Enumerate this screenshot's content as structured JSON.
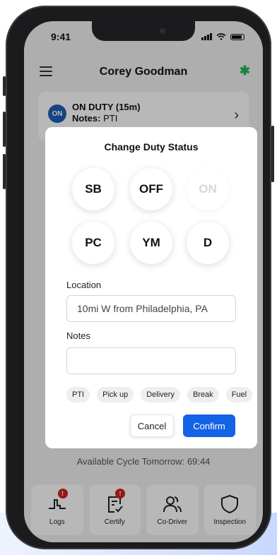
{
  "status_bar": {
    "time": "9:41"
  },
  "header": {
    "title": "Corey Goodman",
    "bluetooth_icon": "bluetooth-icon"
  },
  "duty_card": {
    "badge": "ON",
    "status": "ON DUTY (15m)",
    "notes_label": "Notes:",
    "notes_value": "PTI"
  },
  "modal": {
    "title": "Change Duty Status",
    "statuses": [
      {
        "label": "SB",
        "enabled": true
      },
      {
        "label": "OFF",
        "enabled": true
      },
      {
        "label": "ON",
        "enabled": false
      },
      {
        "label": "PC",
        "enabled": true
      },
      {
        "label": "YM",
        "enabled": true
      },
      {
        "label": "D",
        "enabled": true
      }
    ],
    "location_label": "Location",
    "location_value": "10mi W from Philadelphia, PA",
    "notes_label": "Notes",
    "notes_value": "",
    "chips": [
      "PTI",
      "Pick up",
      "Delivery",
      "Break",
      "Fuel",
      "S"
    ],
    "cancel_label": "Cancel",
    "confirm_label": "Confirm"
  },
  "cycle_text": "Available Cycle Tomorrow: 69:44",
  "bottom_nav": [
    {
      "label": "Logs",
      "icon": "logs-icon",
      "badge": "!"
    },
    {
      "label": "Certify",
      "icon": "certify-icon",
      "badge": "!"
    },
    {
      "label": "Co-Driver",
      "icon": "co-driver-icon",
      "badge": ""
    },
    {
      "label": "Inspection",
      "icon": "shield-icon",
      "badge": ""
    }
  ],
  "colors": {
    "accent": "#1463e6",
    "on_badge": "#1d5fb8",
    "bluetooth": "#1fb356",
    "alert": "#d02020"
  }
}
